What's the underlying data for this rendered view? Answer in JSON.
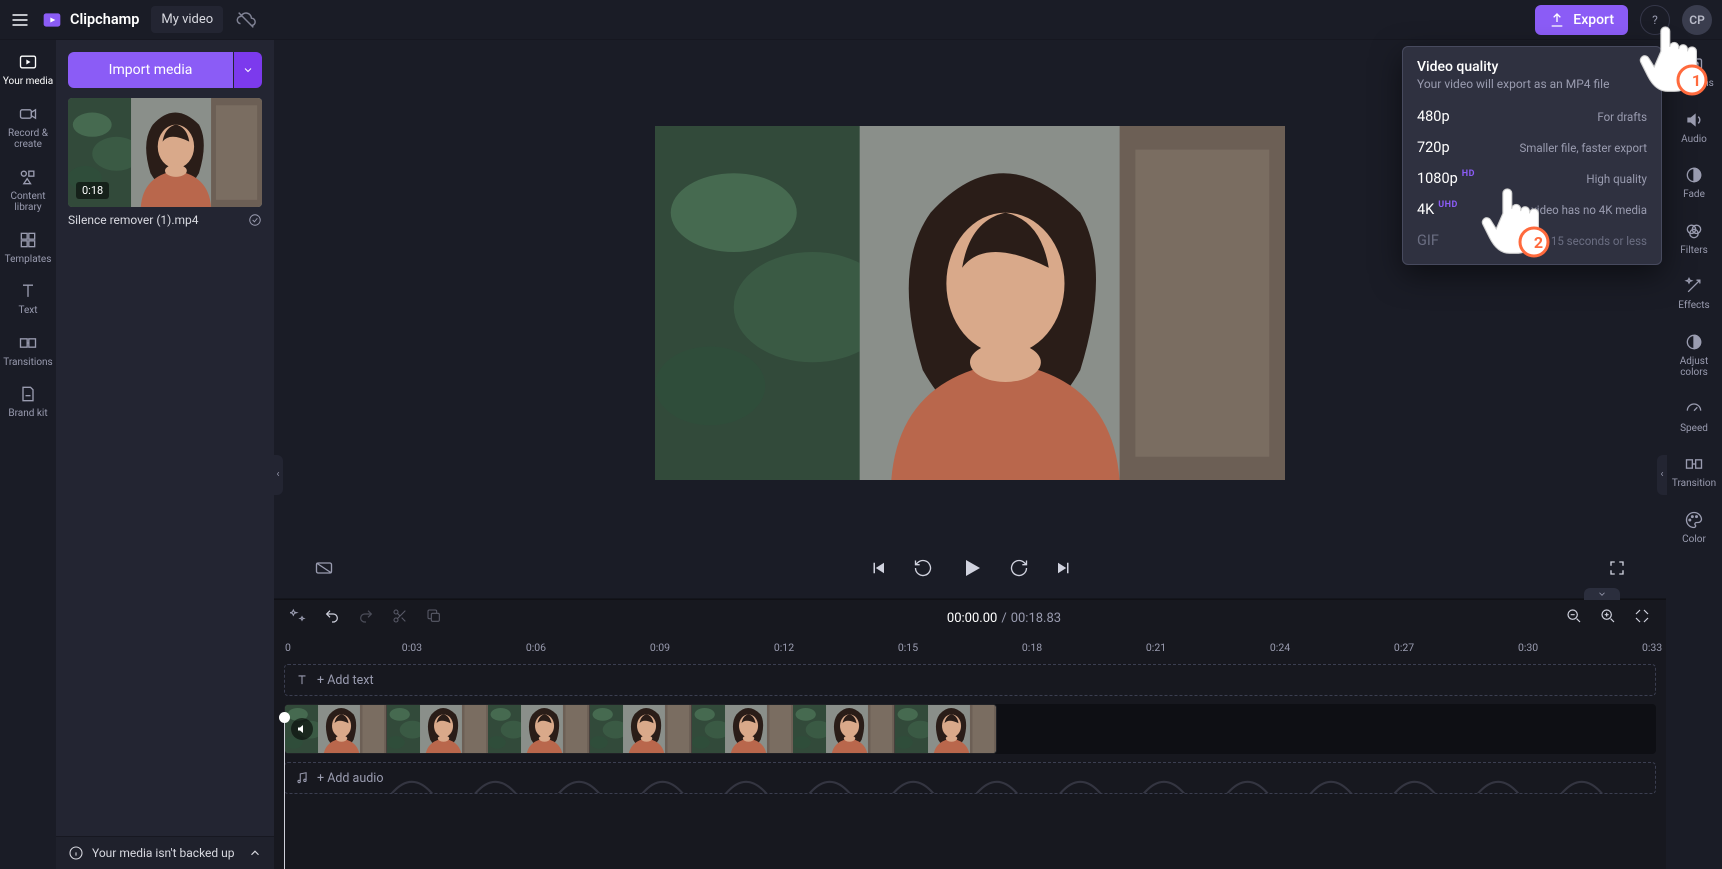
{
  "header": {
    "brand": "Clipchamp",
    "project_title": "My video",
    "export_label": "Export",
    "avatar_initials": "CP"
  },
  "left_rail": [
    {
      "id": "your-media",
      "label": "Your media"
    },
    {
      "id": "record-create",
      "label": "Record & create"
    },
    {
      "id": "content-library",
      "label": "Content library"
    },
    {
      "id": "templates",
      "label": "Templates"
    },
    {
      "id": "text",
      "label": "Text"
    },
    {
      "id": "transitions",
      "label": "Transitions"
    },
    {
      "id": "brand-kit",
      "label": "Brand kit"
    }
  ],
  "media_panel": {
    "import_label": "Import media",
    "clip": {
      "name": "Silence remover (1).mp4",
      "duration": "0:18"
    },
    "backup_notice": "Your media isn't backed up"
  },
  "right_rail": [
    {
      "id": "captions",
      "label": "Captions"
    },
    {
      "id": "audio",
      "label": "Audio"
    },
    {
      "id": "fade",
      "label": "Fade"
    },
    {
      "id": "filters",
      "label": "Filters"
    },
    {
      "id": "effects",
      "label": "Effects"
    },
    {
      "id": "adjust-colors",
      "label": "Adjust colors"
    },
    {
      "id": "speed",
      "label": "Speed"
    },
    {
      "id": "transition",
      "label": "Transition"
    },
    {
      "id": "color",
      "label": "Color"
    }
  ],
  "export_popover": {
    "title": "Video quality",
    "subtitle": "Your video will export as an MP4 file",
    "options": [
      {
        "label": "480p",
        "badge": "",
        "note": "For drafts",
        "disabled": false
      },
      {
        "label": "720p",
        "badge": "",
        "note": "Smaller file, faster export",
        "disabled": false
      },
      {
        "label": "1080p",
        "badge": "HD",
        "note": "High quality",
        "disabled": false
      },
      {
        "label": "4K",
        "badge": "UHD",
        "note": "Your video has no 4K media",
        "disabled": false
      },
      {
        "label": "GIF",
        "badge": "",
        "note": "For videos 15 seconds or less",
        "disabled": true
      }
    ]
  },
  "annotations": {
    "pointer1_label": "1",
    "pointer2_label": "2"
  },
  "timeline": {
    "current": "00:00.00",
    "separator": "/",
    "total": "00:18.83",
    "ticks": [
      "0",
      "0:03",
      "0:06",
      "0:09",
      "0:12",
      "0:15",
      "0:18",
      "0:21",
      "0:24",
      "0:27",
      "0:30",
      "0:33"
    ],
    "text_track_placeholder": "+ Add text",
    "audio_track_placeholder": "+ Add audio"
  }
}
